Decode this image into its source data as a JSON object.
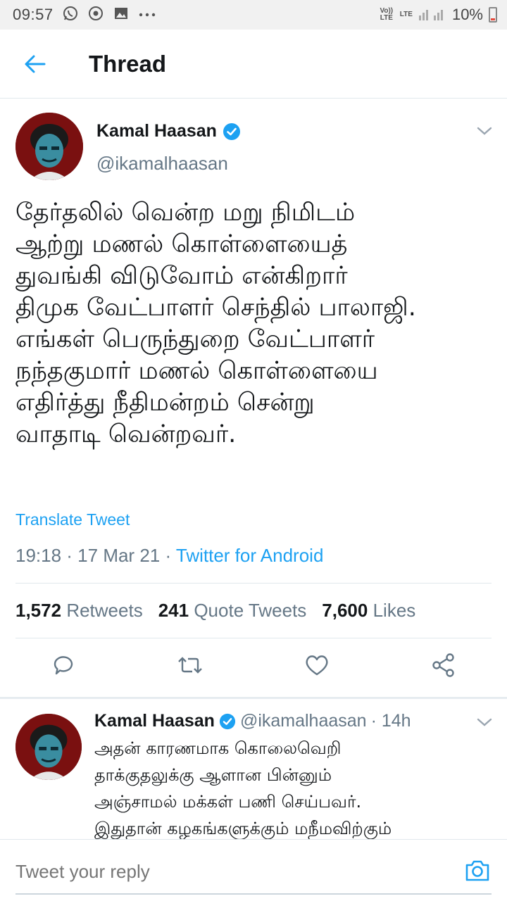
{
  "status_bar": {
    "time": "09:57",
    "volte": "Vo)) LTE",
    "lte": "LTE",
    "battery": "10%"
  },
  "header": {
    "title": "Thread"
  },
  "main_tweet": {
    "name": "Kamal Haasan",
    "handle": "@ikamalhaasan",
    "text": "தேர்தலில் வென்ற மறு நிமிடம்\nஆற்று மணல் கொள்ளையைத்\nதுவங்கி விடுவோம் என்கிறார்\nதிமுக வேட்பாளர் செந்தில் பாலாஜி.\nஎங்கள் பெருந்துறை வேட்பாளர்\nநந்தகுமார் மணல் கொள்ளையை\nஎதிர்த்து நீதிமன்றம் சென்று\nவாதாடி வென்றவர்.",
    "translate": "Translate Tweet",
    "time": "19:18 · 17 Mar 21 · ",
    "source": "Twitter for Android",
    "stats": {
      "retweets_count": "1,572",
      "retweets_label": "Retweets",
      "quotes_count": "241",
      "quotes_label": "Quote Tweets",
      "likes_count": "7,600",
      "likes_label": "Likes"
    }
  },
  "reply_tweet": {
    "name": "Kamal Haasan",
    "handle": "@ikamalhaasan",
    "age": "· 14h",
    "text": "அதன் காரணமாக கொலைவெறி\nதாக்குதலுக்கு ஆளான பின்னும்\nஅஞ்சாமல் மக்கள் பணி செய்பவர்.\nஇதுதான் கழகங்களுக்கும் மநீமவிற்கும்"
  },
  "reply_bar": {
    "placeholder": "Tweet your reply"
  },
  "colors": {
    "accent": "#1da1f2",
    "muted": "#657786",
    "divider": "#e1e8ed"
  }
}
